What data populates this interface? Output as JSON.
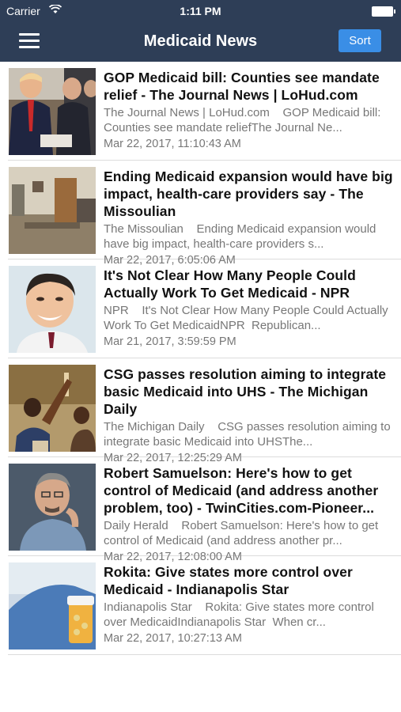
{
  "status_bar": {
    "carrier": "Carrier",
    "time": "1:11 PM"
  },
  "nav": {
    "title": "Medicaid News",
    "sort_label": "Sort"
  },
  "colors": {
    "header_bg": "#2e3e57",
    "sort_button": "#3a8ee6"
  },
  "articles": [
    {
      "title": "GOP Medicaid bill: Counties see mandate relief - The Journal News | LoHud.com",
      "summary": "The Journal News | LoHud.com    GOP Medicaid bill: Counties see mandate reliefThe Journal Ne...",
      "date": "Mar 22, 2017, 11:10:43 AM",
      "thumbnail_icon": "politicians-photo"
    },
    {
      "title": "Ending Medicaid expansion would have big impact, health-care providers say - The Missoulian",
      "summary": "The Missoulian    Ending Medicaid expansion would have big impact, health-care providers s...",
      "date": "Mar 22, 2017, 6:05:06 AM",
      "thumbnail_icon": "clinic-hallway-photo"
    },
    {
      "title": "It's Not Clear How Many People Could Actually Work To Get Medicaid - NPR",
      "summary": "NPR    It's Not Clear How Many People Could Actually Work To Get MedicaidNPR  Republican...",
      "date": "Mar 21, 2017, 3:59:59 PM",
      "thumbnail_icon": "smiling-man-photo"
    },
    {
      "title": "CSG passes resolution aiming to integrate basic Medicaid into UHS - The Michigan Daily",
      "summary": "The Michigan Daily    CSG passes resolution aiming to integrate basic Medicaid into UHSThe...",
      "date": "Mar 22, 2017, 12:25:29 AM",
      "thumbnail_icon": "students-meeting-photo"
    },
    {
      "title": "Robert Samuelson: Here's how to get control of Medicaid (and address another problem, too) - TwinCities.com-Pioneer...",
      "summary": "Daily Herald    Robert Samuelson: Here's how to get control of Medicaid (and address another pr...",
      "date": "Mar 22, 2017, 12:08:00 AM",
      "thumbnail_icon": "columnist-portrait-photo"
    },
    {
      "title": "Rokita: Give states more control over Medicaid - Indianapolis Star",
      "summary": "Indianapolis Star    Rokita: Give states more control over MedicaidIndianapolis Star  When cr...",
      "date": "Mar 22, 2017, 10:27:13 AM",
      "thumbnail_icon": "pill-bottle-photo"
    }
  ]
}
